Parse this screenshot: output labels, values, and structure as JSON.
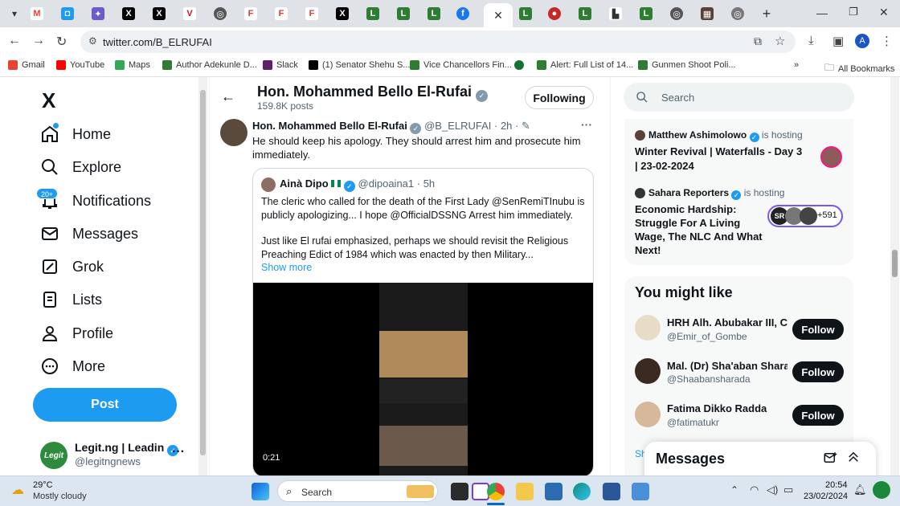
{
  "browser": {
    "url": "twitter.com/B_ELRUFAI",
    "bookmarks": [
      {
        "label": "Gmail",
        "color": "#ea4335"
      },
      {
        "label": "YouTube",
        "color": "#ff0000"
      },
      {
        "label": "Maps",
        "color": "#34a853"
      },
      {
        "label": "Author Adekunle D...",
        "color": "#2e7d32"
      },
      {
        "label": "Slack",
        "color": "#611f69"
      },
      {
        "label": "(1) Senator Shehu S...",
        "color": "#000000"
      },
      {
        "label": "Vice Chancellors Fin...",
        "color": "#2e7d32"
      },
      {
        "label": "Alert: Full List of 14...",
        "color": "#2e7d32"
      },
      {
        "label": "Gunmen Shoot Poli...",
        "color": "#2e7d32"
      }
    ],
    "all_bookmarks": "All Bookmarks"
  },
  "sidebar": {
    "logo": "X",
    "items": [
      {
        "label": "Home",
        "icon": "home-icon"
      },
      {
        "label": "Explore",
        "icon": "search-icon"
      },
      {
        "label": "Notifications",
        "icon": "bell-icon",
        "badge": "20+"
      },
      {
        "label": "Messages",
        "icon": "mail-icon"
      },
      {
        "label": "Grok",
        "icon": "grok-icon"
      },
      {
        "label": "Lists",
        "icon": "list-icon"
      },
      {
        "label": "Profile",
        "icon": "person-icon"
      },
      {
        "label": "More",
        "icon": "more-circle-icon"
      }
    ],
    "post_label": "Post",
    "account": {
      "name": "Legit.ng | Leadin",
      "handle": "@legitngnews",
      "avatar_text": "Legit"
    }
  },
  "header": {
    "name": "Hon. Mohammed Bello El-Rufai",
    "posts": "159.8K posts",
    "following_label": "Following"
  },
  "tweet": {
    "name": "Hon. Mohammed Bello El-Rufai",
    "handle": "@B_ELRUFAI",
    "time": "· 2h ·",
    "text": "He should keep his apology. They should arrest him and prosecute him immediately.",
    "quote": {
      "name": "Ainà Dipo",
      "handle": "@dipoaina1",
      "time": "· 5h",
      "text1": "The cleric who called for the death of the First Lady @SenRemiTInubu is publicly apologizing... I hope @OfficialDSSNG Arrest him immediately.",
      "text2": "Just like El rufai emphasized, perhaps we should revisit the Religious Preaching Edict of 1984 which was enacted by then Military...",
      "show_more": "Show more",
      "video_time": "0:21"
    }
  },
  "right": {
    "search_placeholder": "Search",
    "spaces": [
      {
        "host": "Matthew Ashimolowo",
        "hosting": "is hosting",
        "title": "Winter Revival | Waterfalls - Day 3 | 23-02-2024"
      },
      {
        "host": "Sahara Reporters",
        "hosting": "is hosting",
        "title": "Economic Hardship: Struggle For A Living Wage, The NLC And What Next!",
        "listeners": "+591",
        "badge": "SR"
      }
    ],
    "you_might_like": "You might like",
    "suggestions": [
      {
        "name": "HRH Alh. Abubakar III, CI",
        "handle": "@Emir_of_Gombe",
        "follow": "Follow"
      },
      {
        "name": "Mal. (Dr) Sha'aban Shara",
        "handle": "@Shaabansharada",
        "follow": "Follow"
      },
      {
        "name": "Fatima Dikko Radda",
        "handle": "@fatimatukr",
        "follow": "Follow"
      }
    ],
    "show_more_partial": "Sh",
    "messages_label": "Messages"
  },
  "taskbar": {
    "temp": "29°C",
    "weather": "Mostly cloudy",
    "search": "Search",
    "time": "20:54",
    "date": "23/02/2024"
  },
  "colors": {
    "accent": "#1d9bf0",
    "text": "#0f1419",
    "muted": "#536471"
  }
}
